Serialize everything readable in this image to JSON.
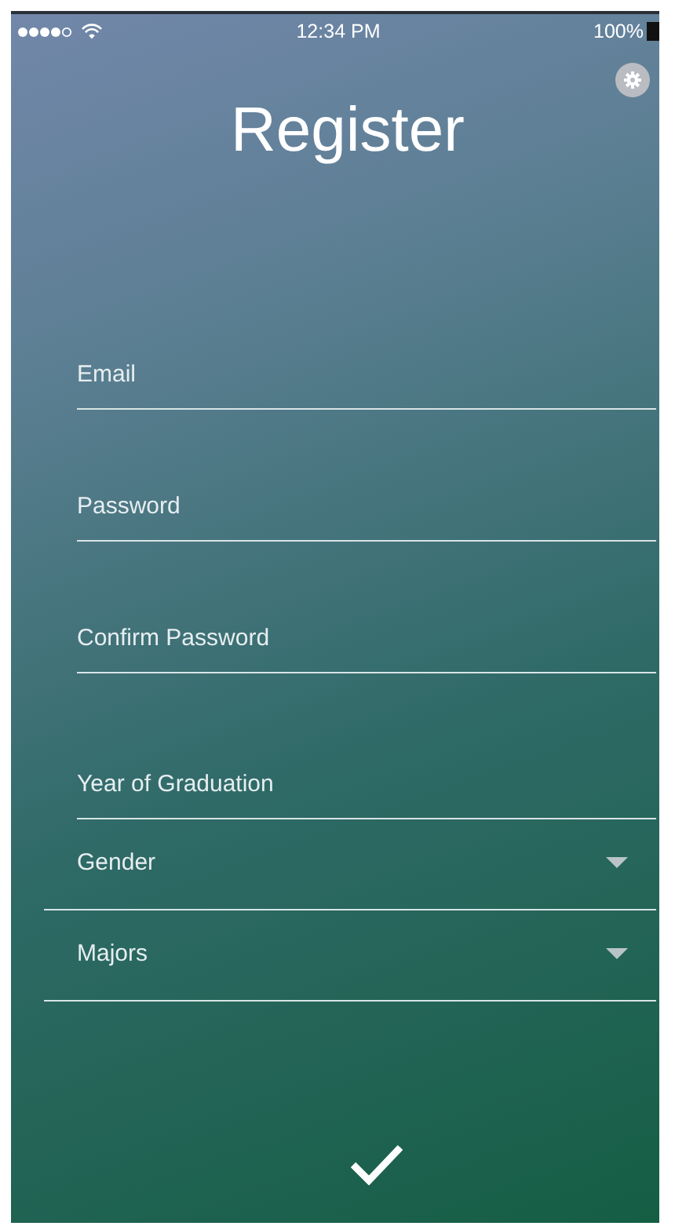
{
  "status_bar": {
    "time": "12:34 PM",
    "battery": "100%"
  },
  "title": "Register",
  "fields": [
    {
      "kind": "text",
      "placeholder": "Email"
    },
    {
      "kind": "password",
      "placeholder": "Password"
    },
    {
      "kind": "password",
      "placeholder": "Confirm Password"
    },
    {
      "kind": "text",
      "placeholder": "Year of Graduation"
    },
    {
      "kind": "select",
      "label": "Gender"
    },
    {
      "kind": "select",
      "label": "Majors"
    }
  ]
}
